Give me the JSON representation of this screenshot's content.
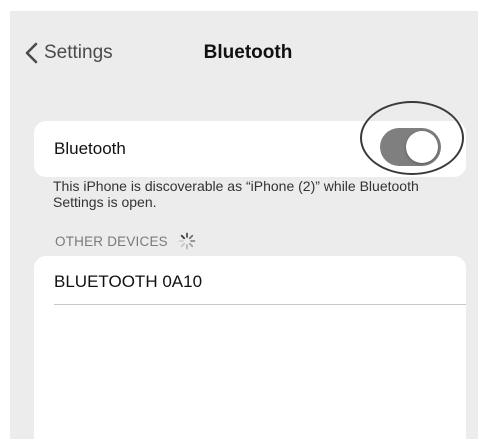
{
  "navbar": {
    "back_label": "Settings",
    "back_icon": "chevron-left-icon",
    "title": "Bluetooth"
  },
  "bluetooth_toggle": {
    "label": "Bluetooth",
    "state": "on",
    "on_color": "#7f7f7f"
  },
  "discoverable_note": "This iPhone is discoverable as “iPhone (2)” while Bluetooth Settings is open.",
  "other_devices": {
    "header": "OTHER DEVICES",
    "loading_icon": "spinner-icon",
    "devices": [
      {
        "name": "BLUETOOTH 0A10"
      }
    ]
  }
}
